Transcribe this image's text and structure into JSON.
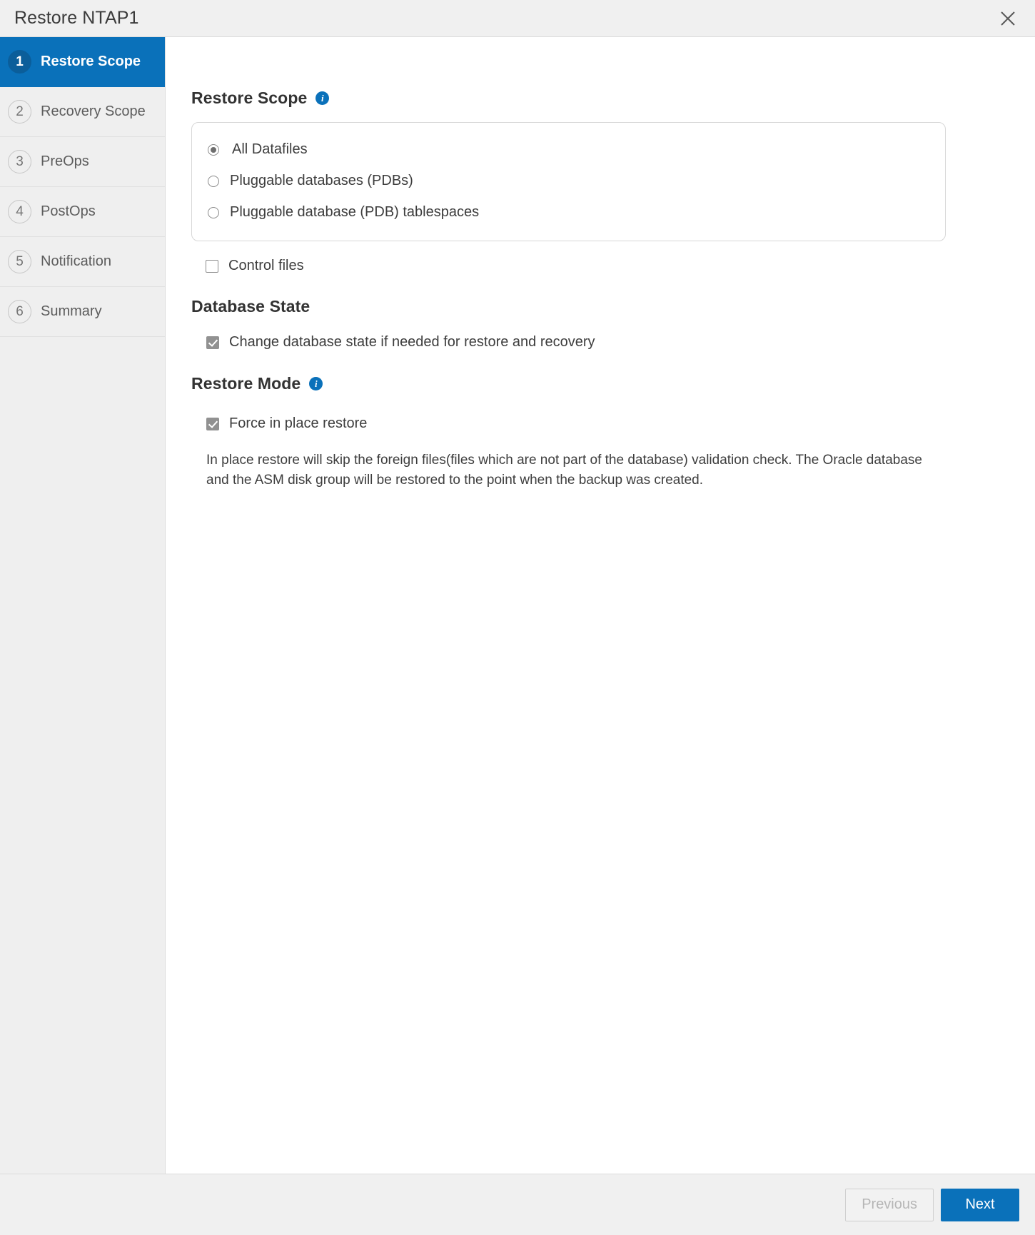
{
  "window": {
    "title": "Restore NTAP1",
    "close_icon": "close-icon"
  },
  "sidebar": {
    "steps": [
      {
        "number": "1",
        "label": "Restore Scope",
        "active": true
      },
      {
        "number": "2",
        "label": "Recovery Scope",
        "active": false
      },
      {
        "number": "3",
        "label": "PreOps",
        "active": false
      },
      {
        "number": "4",
        "label": "PostOps",
        "active": false
      },
      {
        "number": "5",
        "label": "Notification",
        "active": false
      },
      {
        "number": "6",
        "label": "Summary",
        "active": false
      }
    ]
  },
  "main": {
    "restore_scope": {
      "heading": "Restore Scope",
      "info_icon": "info-icon",
      "info_glyph": "i",
      "options": [
        {
          "label": "All Datafiles",
          "selected": true
        },
        {
          "label": "Pluggable databases (PDBs)",
          "selected": false
        },
        {
          "label": "Pluggable database (PDB) tablespaces",
          "selected": false
        }
      ],
      "control_files": {
        "label": "Control files",
        "checked": false
      }
    },
    "database_state": {
      "heading": "Database State",
      "change_state": {
        "label": "Change database state if needed for restore and recovery",
        "checked": true
      }
    },
    "restore_mode": {
      "heading": "Restore Mode",
      "info_icon": "info-icon",
      "info_glyph": "i",
      "force_in_place": {
        "label": "Force in place restore",
        "checked": true
      },
      "description": "In place restore will skip the foreign files(files which are not part of the database) validation check. The Oracle database and the ASM disk group will be restored to the point when the backup was created."
    }
  },
  "footer": {
    "previous_label": "Previous",
    "next_label": "Next"
  },
  "colors": {
    "accent": "#0a71ba",
    "accent_dark": "#0b5e9a",
    "chrome": "#f0f0f0",
    "sidebar": "#efefef",
    "text": "#3d3d3d"
  }
}
